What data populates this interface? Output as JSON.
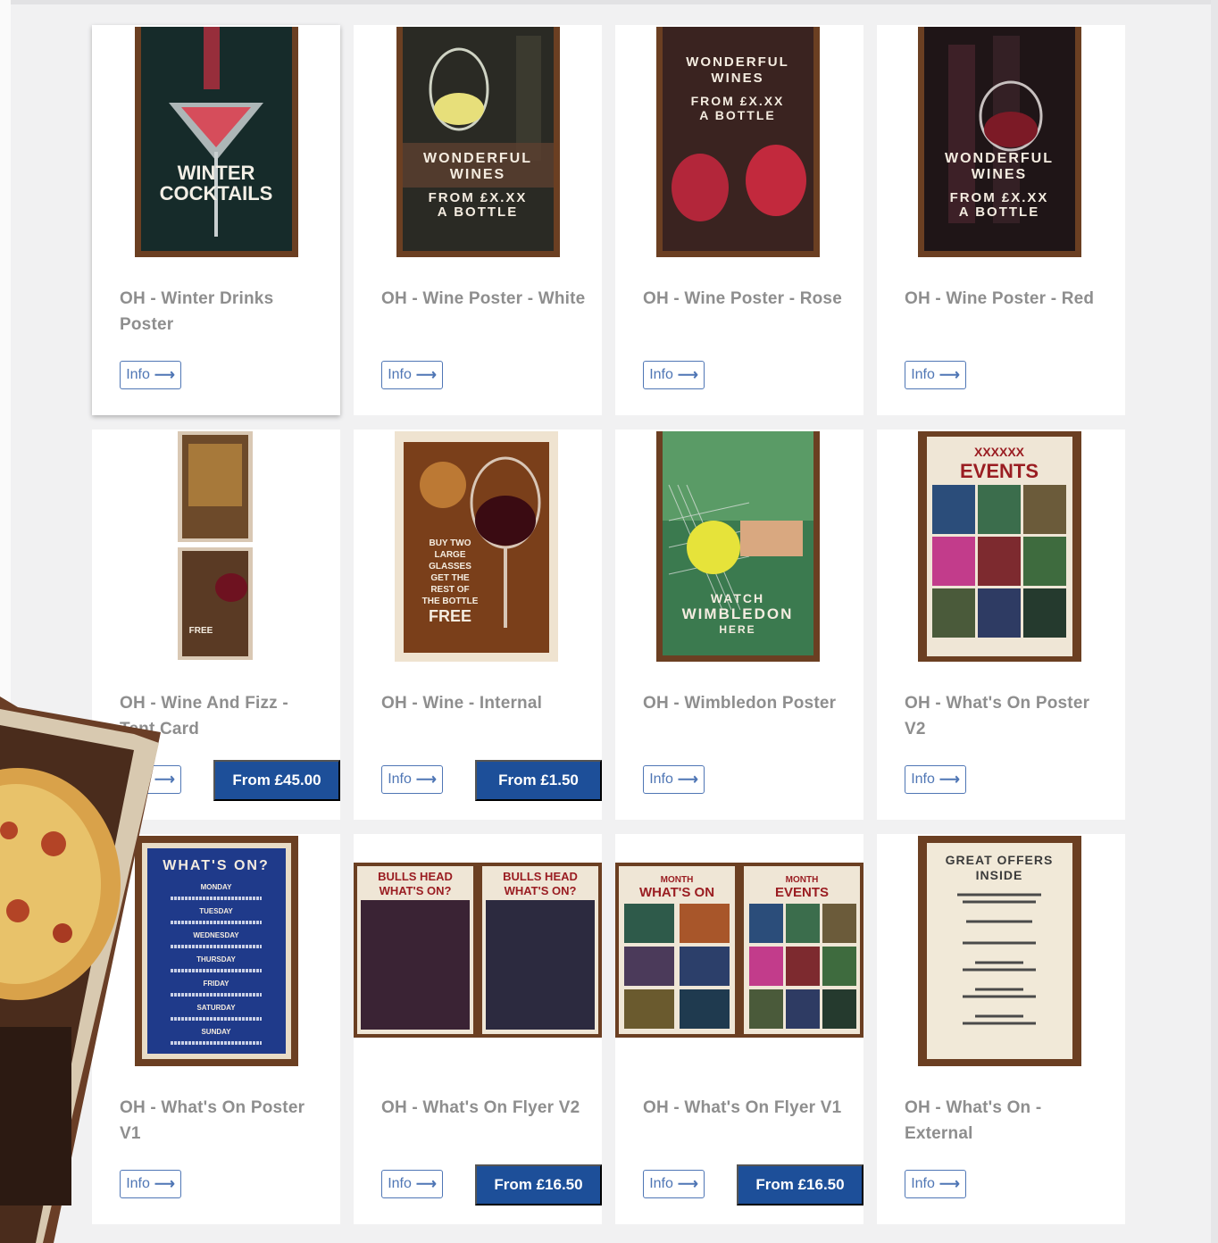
{
  "products": [
    {
      "title": "OH - Winter Drinks Poster",
      "info_label": "Info",
      "price": null,
      "thumb": "winter-cocktails-poster",
      "poster_text": [
        "WINTER",
        "COCKTAILS"
      ]
    },
    {
      "title": "OH - Wine Poster - White",
      "info_label": "Info",
      "price": null,
      "thumb": "white-wine-poster",
      "poster_text": [
        "WONDERFUL",
        "WINES",
        "FROM £X.XX",
        "A BOTTLE"
      ]
    },
    {
      "title": "OH - Wine Poster - Rose",
      "info_label": "Info",
      "price": null,
      "thumb": "rose-wine-poster",
      "poster_text": [
        "WONDERFUL",
        "WINES",
        "FROM £X.XX",
        "A BOTTLE"
      ]
    },
    {
      "title": "OH - Wine Poster - Red",
      "info_label": "Info",
      "price": null,
      "thumb": "red-wine-poster",
      "poster_text": [
        "WONDERFUL",
        "WINES",
        "FROM £X.XX",
        "A BOTTLE"
      ]
    },
    {
      "title": "OH - Wine And Fizz - Tent Card",
      "info_label": "Info",
      "price": "From £45.00",
      "thumb": "tent-card",
      "poster_text": [
        "FREE"
      ]
    },
    {
      "title": "OH - Wine - Internal",
      "info_label": "Info",
      "price": "From £1.50",
      "thumb": "wine-internal-poster",
      "poster_text": [
        "BUY TWO",
        "LARGE",
        "GLASSES",
        "GET THE",
        "REST OF",
        "THE BOTTLE",
        "FREE"
      ]
    },
    {
      "title": "OH - Wimbledon Poster",
      "info_label": "Info",
      "price": null,
      "thumb": "wimbledon-poster",
      "poster_text": [
        "WATCH",
        "WIMBLEDON",
        "HERE"
      ]
    },
    {
      "title": "OH - What's On Poster V2",
      "info_label": "Info",
      "price": null,
      "thumb": "events-poster",
      "poster_text": [
        "XXXXXX",
        "EVENTS"
      ]
    },
    {
      "title": "OH - What's On Poster V1",
      "info_label": "Info",
      "price": null,
      "thumb": "whats-on-poster",
      "poster_text": [
        "WHAT'S ON?",
        "MONDAY",
        "TUESDAY",
        "WEDNESDAY",
        "THURSDAY",
        "FRIDAY",
        "SATURDAY",
        "SUNDAY"
      ]
    },
    {
      "title": "OH - What's On Flyer V2",
      "info_label": "Info",
      "price": "From £16.50",
      "thumb": "bulls-head-flyer",
      "poster_text": [
        "BULLS HEAD",
        "WHAT'S ON?"
      ]
    },
    {
      "title": "OH - What's On Flyer V1",
      "info_label": "Info",
      "price": "From £16.50",
      "thumb": "month-flyer",
      "poster_text": [
        "MONTH",
        "WHAT'S ON",
        "MONTH",
        "EVENTS"
      ]
    },
    {
      "title": "OH - What's On - External",
      "info_label": "Info",
      "price": null,
      "thumb": "great-offers-poster",
      "poster_text": [
        "GREAT OFFERS",
        "INSIDE"
      ]
    }
  ],
  "colors": {
    "accent": "#1d4f99",
    "info_border": "#4f76b5",
    "title_text": "#8e8e8e"
  }
}
